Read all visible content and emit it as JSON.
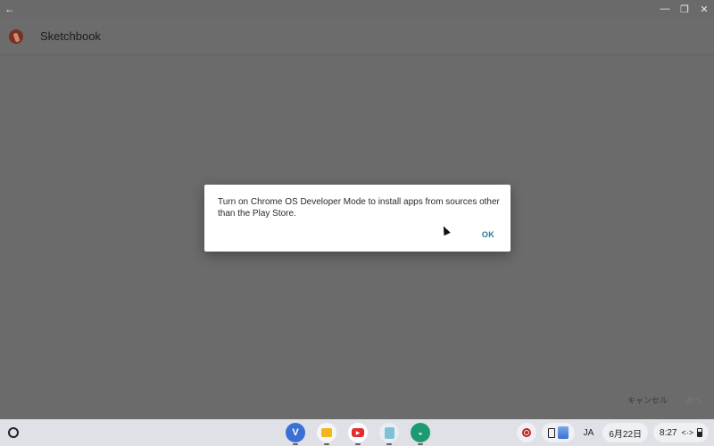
{
  "window": {
    "back_icon": "arrow-left-icon",
    "controls": [
      "minimize-icon",
      "restore-icon",
      "close-icon"
    ]
  },
  "appbar": {
    "title": "Sketchbook"
  },
  "dialog": {
    "message": "Turn on Chrome OS Developer Mode to install apps from sources other than the Play Store.",
    "ok_label": "OK"
  },
  "background_actions": {
    "cancel_label": "キャンセル",
    "next_label": "次へ"
  },
  "shelf": {
    "apps": [
      "vectr-icon",
      "files-icon",
      "youtube-icon",
      "keep-icon",
      "android-icon"
    ],
    "ime": "JA",
    "date": "6月22日",
    "time": "8:27"
  }
}
